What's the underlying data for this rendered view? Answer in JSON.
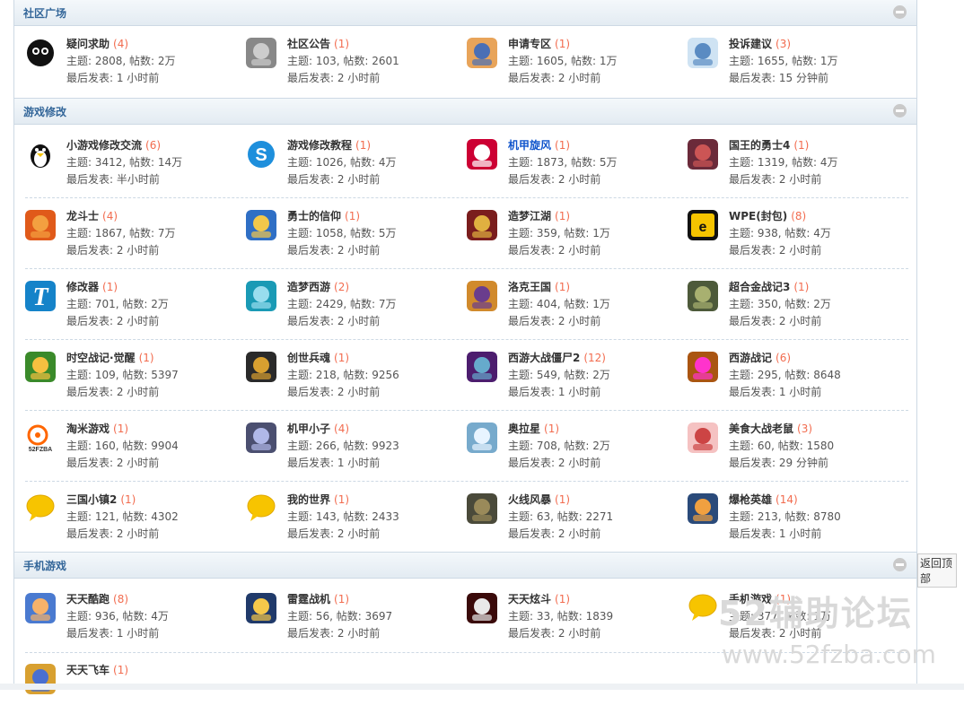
{
  "sections": [
    {
      "title": "社区广场"
    },
    {
      "title": "游戏修改"
    },
    {
      "title": "手机游戏"
    }
  ],
  "labels": {
    "topics": "主题:",
    "posts": "帖数:",
    "last": "最后发表:"
  },
  "forums": [
    {
      "name": "疑问求助",
      "count": "(4)",
      "stats": "主题: 2808, 帖数: 2万",
      "last": "最后发表: 1 小时前",
      "icon": "sootball-icon"
    },
    {
      "name": "社区公告",
      "count": "(1)",
      "stats": "主题: 103, 帖数: 2601",
      "last": "最后发表: 2 小时前",
      "icon": "speaker-icon"
    },
    {
      "name": "申请专区",
      "count": "(1)",
      "stats": "主题: 1605, 帖数: 1万",
      "last": "最后发表: 2 小时前",
      "icon": "student-icon"
    },
    {
      "name": "投诉建议",
      "count": "(3)",
      "stats": "主题: 1655, 帖数: 1万",
      "last": "最后发表: 15 分钟前",
      "icon": "paper-plane-icon"
    },
    {
      "name": "小游戏修改交流",
      "count": "(6)",
      "stats": "主题: 3412, 帖数: 14万",
      "last": "最后发表: 半小时前",
      "icon": "penguin-icon"
    },
    {
      "name": "游戏修改教程",
      "count": "(1)",
      "stats": "主题: 1026, 帖数: 4万",
      "last": "最后发表: 2 小时前",
      "icon": "skype-icon"
    },
    {
      "name": "机甲旋风",
      "count": "(1)",
      "stats": "主题: 1873, 帖数: 5万",
      "last": "最后发表: 2 小时前",
      "icon": "mecha-character-icon"
    },
    {
      "name": "国王的勇士4",
      "count": "(1)",
      "stats": "主题: 1319, 帖数: 4万",
      "last": "最后发表: 2 小时前",
      "icon": "warrior-icon"
    },
    {
      "name": "龙斗士",
      "count": "(4)",
      "stats": "主题: 1867, 帖数: 7万",
      "last": "最后发表: 2 小时前",
      "icon": "dragon-icon"
    },
    {
      "name": "勇士的信仰",
      "count": "(1)",
      "stats": "主题: 1058, 帖数: 5万",
      "last": "最后发表: 2 小时前",
      "icon": "blonde-hero-icon"
    },
    {
      "name": "造梦江湖",
      "count": "(1)",
      "stats": "主题: 359, 帖数: 1万",
      "last": "最后发表: 2 小时前",
      "icon": "jianghu-logo-icon"
    },
    {
      "name": "WPE(封包)",
      "count": "(8)",
      "stats": "主题: 938, 帖数: 4万",
      "last": "最后发表: 2 小时前",
      "icon": "wpe-logo-icon"
    },
    {
      "name": "修改器",
      "count": "(1)",
      "stats": "主题: 701, 帖数: 2万",
      "last": "最后发表: 2 小时前",
      "icon": "letter-t-icon"
    },
    {
      "name": "造梦西游",
      "count": "(2)",
      "stats": "主题: 2429, 帖数: 7万",
      "last": "最后发表: 2 小时前",
      "icon": "wizard-icon"
    },
    {
      "name": "洛克王国",
      "count": "(1)",
      "stats": "主题: 404, 帖数: 1万",
      "last": "最后发表: 2 小时前",
      "icon": "roco-kingdom-icon"
    },
    {
      "name": "超合金战记3",
      "count": "(1)",
      "stats": "主题: 350, 帖数: 2万",
      "last": "最后发表: 2 小时前",
      "icon": "tank-icon"
    },
    {
      "name": "时空战记·觉醒",
      "count": "(1)",
      "stats": "主题: 109, 帖数: 5397",
      "last": "最后发表: 2 小时前",
      "icon": "chibi-characters-icon"
    },
    {
      "name": "创世兵魂",
      "count": "(1)",
      "stats": "主题: 218, 帖数: 9256",
      "last": "最后发表: 2 小时前",
      "icon": "helmet-logo-icon"
    },
    {
      "name": "西游大战僵尸2",
      "count": "(12)",
      "stats": "主题: 549, 帖数: 2万",
      "last": "最后发表: 1 小时前",
      "icon": "zombie-icon"
    },
    {
      "name": "西游战记",
      "count": "(6)",
      "stats": "主题: 295, 帖数: 8648",
      "last": "最后发表: 1 小时前",
      "icon": "monkey-king-icon"
    },
    {
      "name": "淘米游戏",
      "count": "(1)",
      "stats": "主题: 160, 帖数: 9904",
      "last": "最后发表: 2 小时前",
      "icon": "site-logo-icon"
    },
    {
      "name": "机甲小子",
      "count": "(4)",
      "stats": "主题: 266, 帖数: 9923",
      "last": "最后发表: 1 小时前",
      "icon": "robot-icon"
    },
    {
      "name": "奥拉星",
      "count": "(1)",
      "stats": "主题: 708, 帖数: 2万",
      "last": "最后发表: 2 小时前",
      "icon": "crystal-dragon-icon"
    },
    {
      "name": "美食大战老鼠",
      "count": "(3)",
      "stats": "主题: 60, 帖数: 1580",
      "last": "最后发表: 29 分钟前",
      "icon": "anime-girl-icon"
    },
    {
      "name": "三国小镇2",
      "count": "(1)",
      "stats": "主题: 121, 帖数: 4302",
      "last": "最后发表: 2 小时前",
      "icon": "speech-bubble-icon"
    },
    {
      "name": "我的世界",
      "count": "(1)",
      "stats": "主题: 143, 帖数: 2433",
      "last": "最后发表: 2 小时前",
      "icon": "speech-bubble-icon"
    },
    {
      "name": "火线风暴",
      "count": "(1)",
      "stats": "主题: 63, 帖数: 2271",
      "last": "最后发表: 2 小时前",
      "icon": "soldier-icon"
    },
    {
      "name": "爆枪英雄",
      "count": "(14)",
      "stats": "主题: 213, 帖数: 8780",
      "last": "最后发表: 1 小时前",
      "icon": "gunner-icon"
    },
    {
      "name": "天天酷跑",
      "count": "(8)",
      "stats": "主题: 936, 帖数: 4万",
      "last": "最后发表: 1 小时前",
      "icon": "runner-icon"
    },
    {
      "name": "雷霆战机",
      "count": "(1)",
      "stats": "主题: 56, 帖数: 3697",
      "last": "最后发表: 2 小时前",
      "icon": "fighter-jet-icon"
    },
    {
      "name": "天天炫斗",
      "count": "(1)",
      "stats": "主题: 33, 帖数: 1839",
      "last": "最后发表: 2 小时前",
      "icon": "white-hair-fighter-icon"
    },
    {
      "name": "手机游戏",
      "count": "(1)",
      "stats": "主题: 377, 帖数: 1万",
      "last": "最后发表: 2 小时前",
      "icon": "speech-bubble-icon"
    },
    {
      "name": "天天飞车",
      "count": "(1)",
      "stats": "",
      "last": "",
      "icon": "racer-icon"
    }
  ],
  "back_to_top": "返回顶部",
  "watermark": {
    "line1": "52辅助论坛",
    "line2": "www.52fzba.com"
  },
  "colors": {
    "section_title": "#336699",
    "count": "#f26c4f",
    "link_blue": "#1155cc"
  }
}
